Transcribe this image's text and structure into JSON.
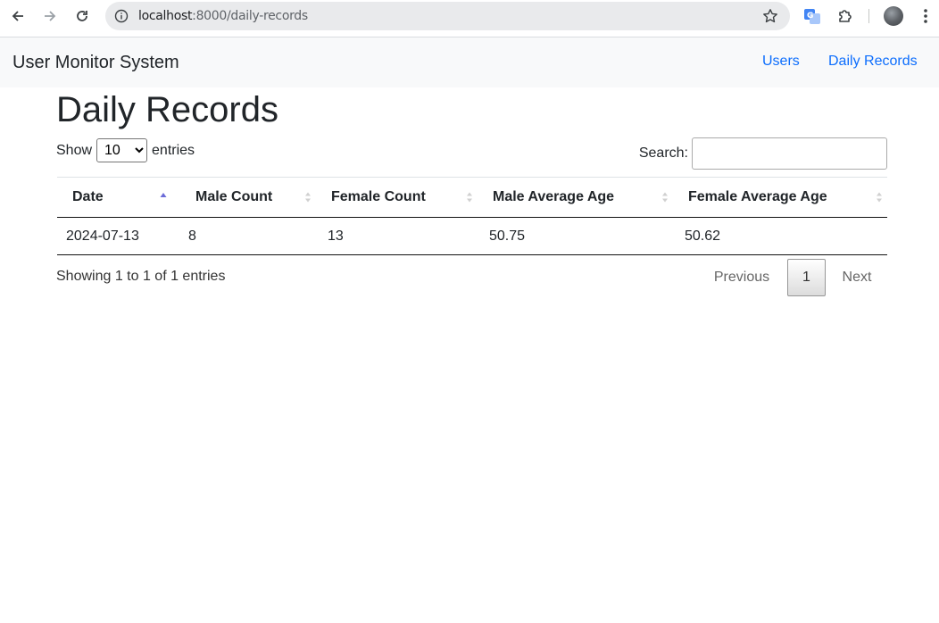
{
  "browser": {
    "url_host": "localhost",
    "url_path": ":8000/daily-records"
  },
  "navbar": {
    "brand": "User Monitor System",
    "links": [
      {
        "label": "Users"
      },
      {
        "label": "Daily Records"
      }
    ]
  },
  "page": {
    "title": "Daily Records"
  },
  "length_control": {
    "show_label": "Show",
    "selected": "10",
    "entries_label": "entries"
  },
  "search": {
    "label": "Search:",
    "value": ""
  },
  "table": {
    "columns": [
      "Date",
      "Male Count",
      "Female Count",
      "Male Average Age",
      "Female Average Age"
    ],
    "sorted_column": "Date",
    "rows": [
      [
        "2024-07-13",
        "8",
        "13",
        "50.75",
        "50.62"
      ]
    ]
  },
  "footer": {
    "info": "Showing 1 to 1 of 1 entries",
    "previous": "Previous",
    "current_page": "1",
    "next": "Next"
  },
  "colors": {
    "link": "#0d6efd",
    "navbar_bg": "#f8f9fa",
    "sort_active": "#6b6bd8",
    "sort_inactive": "#d0d0d0"
  }
}
